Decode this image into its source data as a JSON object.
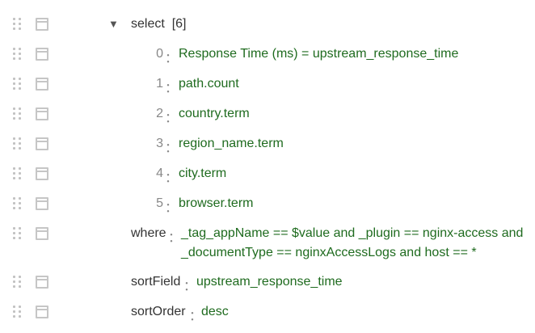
{
  "tree": {
    "select": {
      "key": "select",
      "count_text": "[6]",
      "items": [
        {
          "index": "0",
          "value": "Response Time (ms) = upstream_response_time"
        },
        {
          "index": "1",
          "value": "path.count"
        },
        {
          "index": "2",
          "value": "country.term"
        },
        {
          "index": "3",
          "value": "region_name.term"
        },
        {
          "index": "4",
          "value": "city.term"
        },
        {
          "index": "5",
          "value": "browser.term"
        }
      ]
    },
    "where": {
      "key": "where",
      "value": "_tag_appName == $value and _plugin == nginx-access and _documentType == nginxAccessLogs  and host == *"
    },
    "sortField": {
      "key": "sortField",
      "value": "upstream_response_time"
    },
    "sortOrder": {
      "key": "sortOrder",
      "value": "desc"
    }
  },
  "separator": "："
}
